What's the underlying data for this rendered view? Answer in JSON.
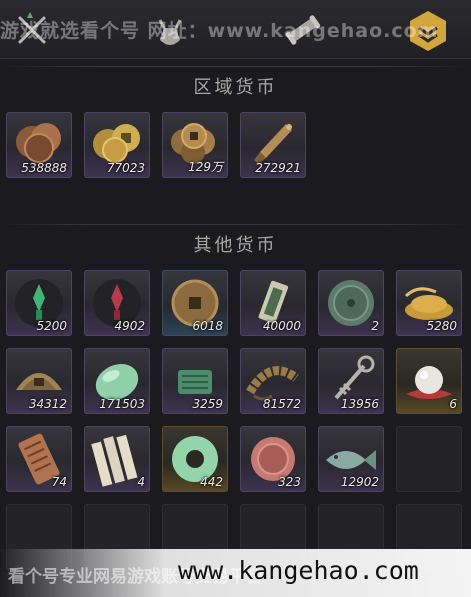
{
  "watermark_top": "游戏就选看个号 网址：www.kangehao.com",
  "sections": {
    "regional_title": "区域货币",
    "other_title": "其他货币"
  },
  "regional": [
    {
      "icon": "copper-coins-stack-icon",
      "count": "538888",
      "quality": "purple"
    },
    {
      "icon": "gold-coins-stack-icon",
      "count": "77023",
      "quality": "purple"
    },
    {
      "icon": "bronze-coins-pile-icon",
      "count": "129万",
      "quality": "purple"
    },
    {
      "icon": "bronze-dagger-token-icon",
      "count": "272921",
      "quality": "purple"
    }
  ],
  "other_row1": [
    {
      "icon": "green-jade-token-icon",
      "count": "5200",
      "quality": "purple"
    },
    {
      "icon": "red-jade-token-icon",
      "count": "4902",
      "quality": "purple"
    },
    {
      "icon": "square-hole-coin-icon",
      "count": "6018",
      "quality": "blue"
    },
    {
      "icon": "jade-plaque-icon",
      "count": "40000",
      "quality": "purple"
    },
    {
      "icon": "green-stone-coin-icon",
      "count": "2",
      "quality": "purple"
    },
    {
      "icon": "grain-pile-icon",
      "count": "5280",
      "quality": "purple"
    }
  ],
  "other_row2": [
    {
      "icon": "bronze-dome-coin-icon",
      "count": "34312",
      "quality": "purple"
    },
    {
      "icon": "jade-pebble-icon",
      "count": "171503",
      "quality": "purple"
    },
    {
      "icon": "jade-slab-icon",
      "count": "3259",
      "quality": "purple"
    },
    {
      "icon": "coin-string-icon",
      "count": "81572",
      "quality": "purple"
    },
    {
      "icon": "key-pendant-icon",
      "count": "13956",
      "quality": "purple"
    },
    {
      "icon": "pearl-icon",
      "count": "6",
      "quality": "gold"
    }
  ],
  "other_row3": [
    {
      "icon": "bronze-tablet-icon",
      "count": "74",
      "quality": "purple"
    },
    {
      "icon": "bamboo-slips-icon",
      "count": "4",
      "quality": "purple"
    },
    {
      "icon": "jade-bi-disc-icon",
      "count": "442",
      "quality": "gold"
    },
    {
      "icon": "red-stone-coin-icon",
      "count": "323",
      "quality": "purple"
    },
    {
      "icon": "jade-fish-icon",
      "count": "12902",
      "quality": "purple"
    }
  ],
  "bottom": {
    "cn_text": "看个号专业网易游戏账号交易平台",
    "url": "www.kangehao.com"
  }
}
